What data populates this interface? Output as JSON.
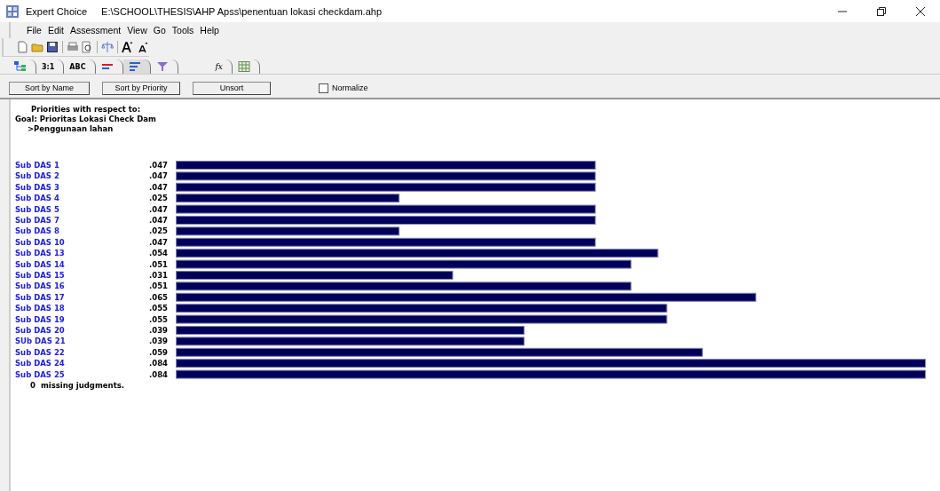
{
  "window": {
    "app": "Expert Choice",
    "path": "E:\\SCHOOL\\THESIS\\AHP Apss\\penentuan lokasi checkdam.ahp"
  },
  "menu": [
    "File",
    "Edit",
    "Assessment",
    "View",
    "Go",
    "Tools",
    "Help"
  ],
  "tabs": [
    {
      "kind": "tree",
      "selected": false
    },
    {
      "kind": "ratio",
      "label": "3:1",
      "selected": false
    },
    {
      "kind": "verbal",
      "label": "ABC",
      "selected": false
    },
    {
      "kind": "graph",
      "selected": false
    },
    {
      "kind": "priorities",
      "selected": true
    },
    {
      "kind": "merge",
      "selected": false
    },
    {
      "kind": "formula",
      "label": "fx",
      "selected": false
    },
    {
      "kind": "grid",
      "selected": false
    }
  ],
  "buttons": [
    "Sort by Name",
    "Sort by Priority",
    "Unsort"
  ],
  "normalize": {
    "label": "Normalize",
    "checked": false
  },
  "header": {
    "title": "Priorities with respect to:",
    "goal": "Goal: Prioritas Lokasi Check Dam",
    "node": ">Penggunaan lahan"
  },
  "chart_data": {
    "type": "bar",
    "orientation": "horizontal",
    "categories": [
      "Sub DAS 1",
      "Sub DAS 2",
      "Sub DAS 3",
      "Sub DAS 4",
      "Sub DAS 5",
      "Sub DAS 7",
      "Sub DAS 8",
      "Sub DAS 10",
      "Sub DAS 13",
      "Sub DAS 14",
      "Sub DAS 15",
      "Sub DAS 16",
      "Sub DAS 17",
      "Sub DAS 18",
      "Sub DAS 19",
      "Sub DAS 20",
      "SUb DAS 21",
      "Sub DAS 22",
      "Sub DAS 24",
      "Sub DAS 25"
    ],
    "values": [
      0.047,
      0.047,
      0.047,
      0.025,
      0.047,
      0.047,
      0.025,
      0.047,
      0.054,
      0.051,
      0.031,
      0.051,
      0.065,
      0.055,
      0.055,
      0.039,
      0.039,
      0.059,
      0.084,
      0.084
    ],
    "value_labels": [
      ".047",
      ".047",
      ".047",
      ".025",
      ".047",
      ".047",
      ".025",
      ".047",
      ".054",
      ".051",
      ".031",
      ".051",
      ".065",
      ".055",
      ".055",
      ".039",
      ".039",
      ".059",
      ".084",
      ".084"
    ]
  },
  "missing": {
    "count": "0",
    "label": "missing judgments."
  }
}
